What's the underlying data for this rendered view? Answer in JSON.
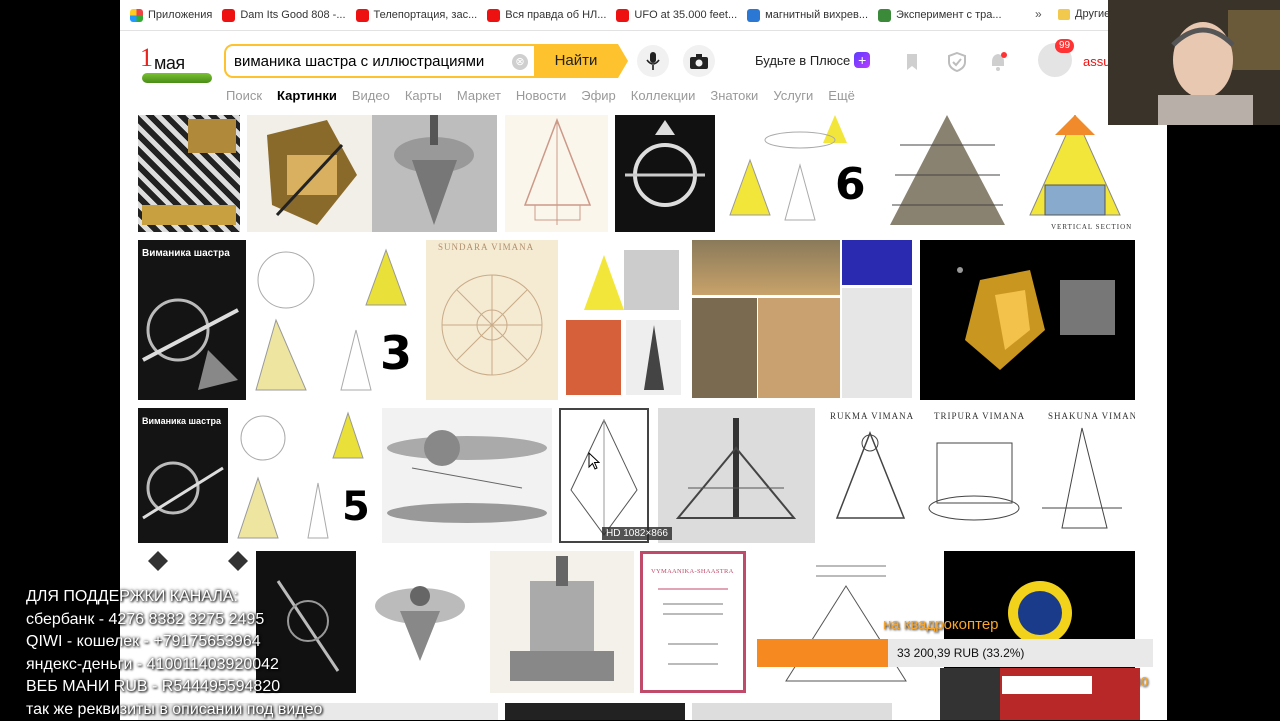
{
  "bookmarks": [
    {
      "label": "Приложения",
      "color": "#e44"
    },
    {
      "label": "Dam Its Good 808 -...",
      "color": "#e11"
    },
    {
      "label": "Телепортация, зас...",
      "color": "#e11"
    },
    {
      "label": "Вся правда об НЛ...",
      "color": "#e11"
    },
    {
      "label": "UFO at 35.000 feet...",
      "color": "#e11"
    },
    {
      "label": "магнитный вихрев...",
      "color": "#2a78d4"
    },
    {
      "label": "Эксперимент с тра...",
      "color": "#3a8a3a"
    }
  ],
  "bookmarks_more": "»",
  "bookmarks_other": "Другие",
  "logo": {
    "one": "1",
    "text": "мая"
  },
  "search": {
    "query": "виманика шастра с иллюстрациями",
    "clear_symbol": "⊗",
    "button": "Найти"
  },
  "header": {
    "plus_label": "Будьте в Плюсе",
    "plus_badge": "+",
    "notifications": "99",
    "user": "assu"
  },
  "tabs": [
    "Поиск",
    "Картинки",
    "Видео",
    "Карты",
    "Маркет",
    "Новости",
    "Эфир",
    "Коллекции",
    "Знатоки",
    "Услуги",
    "Ещё"
  ],
  "active_tab": "Картинки",
  "thumbs": {
    "n3": "3",
    "n5": "5",
    "n6": "6",
    "sundara": "SUNDARA VIMANA",
    "vertical_section": "VERTICAL SECTION",
    "rukma": "RUKMA VIMANA",
    "tripura": "TRIPURA VIMANA",
    "shakuna": "SHAKUNA VIMANA",
    "cover_title": "VYMAANIKA-SHAASTRA",
    "book_title": "Виманика шастра"
  },
  "hd_badge": "HD 1082×866",
  "donation": {
    "line1": "ДЛЯ  ПОДДЕРЖКИ  КАНАЛА:",
    "line2": "сбербанк -  4276 8382 3275 2495",
    "line3": "QIWI - кошелек -  +79175653964",
    "line4": "яндекс-деньги - 410011403920042",
    "line5": "ВЕБ МАНИ RUB  - R544495594820",
    "line6": "так же реквизиты в описании под видео"
  },
  "goal": {
    "title": "на квадрокоптер",
    "close": "×",
    "amount": "33 200,39 RUB (33.2%)",
    "progress": 0.332,
    "target": "100 000"
  },
  "colors": {
    "accent": "#fdc22d",
    "goal_fill": "#f68a20",
    "goal_text": "#f8a52a"
  }
}
